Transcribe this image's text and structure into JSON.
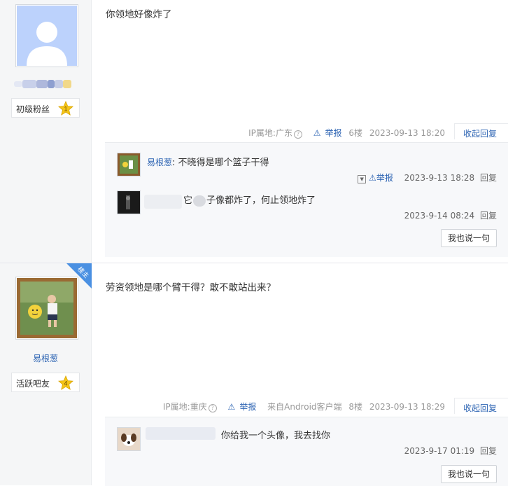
{
  "posts": [
    {
      "level_title": "初级粉丝",
      "level_num": "1",
      "content": "你领地好像炸了",
      "ip": "IP属地:广东",
      "report": "举报",
      "floor": "6楼",
      "time": "2023-09-13 18:20",
      "reply_toggle": "收起回复",
      "replies": [
        {
          "name": "易根葱",
          "text": "不晓得是哪个篮子干得",
          "time": "2023-9-13 18:28",
          "reply": "回复",
          "report": "举报"
        },
        {
          "text": "它",
          "text2": "子像都炸了，何止领地炸了",
          "time": "2023-9-14 08:24",
          "reply": "回复"
        }
      ],
      "say_button": "我也说一句"
    },
    {
      "badge": "楼主",
      "username": "易根葱",
      "level_title": "活跃吧友",
      "level_num": "4",
      "content": "劳资领地是哪个臂干得？敢不敢站出来？",
      "ip": "IP属地:重庆",
      "report": "举报",
      "source": "来自Android客户端",
      "floor": "8楼",
      "time": "2023-09-13 18:29",
      "reply_toggle": "收起回复",
      "replies": [
        {
          "text": "你给我一个头像，我去找你",
          "time": "2023-9-17 01:19",
          "reply": "回复"
        }
      ],
      "say_button": "我也说一句"
    }
  ],
  "colors": {
    "link": "#2d64b3",
    "star": "#f5c518",
    "badge": "#4a90e2"
  }
}
